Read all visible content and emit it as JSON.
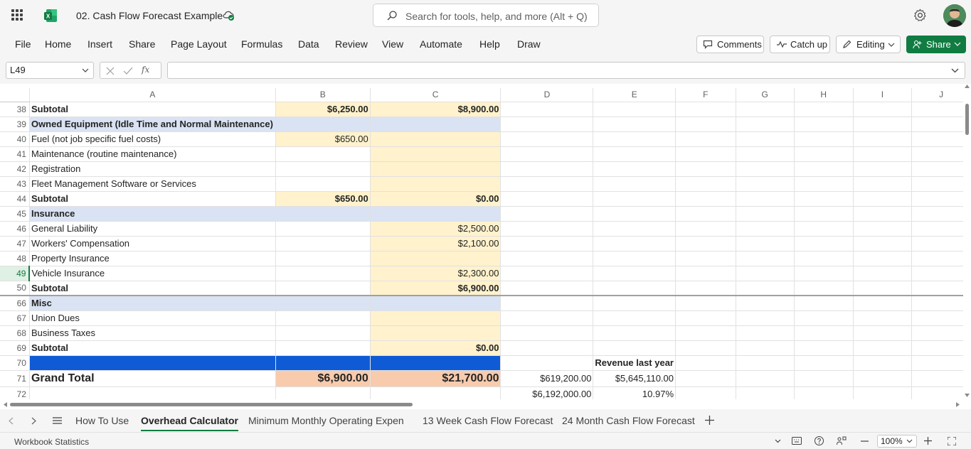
{
  "title_bar": {
    "doc_title": "02. Cash Flow Forecast Example",
    "search_placeholder": "Search for tools, help, and more (Alt + Q)"
  },
  "menu": [
    "File",
    "Home",
    "Insert",
    "Share",
    "Page Layout",
    "Formulas",
    "Data",
    "Review",
    "View",
    "Automate",
    "Help",
    "Draw"
  ],
  "ribbon_buttons": {
    "comments": "Comments",
    "catch_up": "Catch up",
    "editing": "Editing",
    "share": "Share"
  },
  "formula_bar": {
    "name_box": "L49",
    "fx": "fx",
    "formula": ""
  },
  "columns": [
    "A",
    "B",
    "C",
    "D",
    "E",
    "F",
    "G",
    "H",
    "I",
    "J"
  ],
  "rows": [
    {
      "n": "38",
      "a": "Subtotal",
      "b": "$6,250.00",
      "c": "$8,900.00",
      "d": "",
      "e": ""
    },
    {
      "n": "39",
      "a": "Owned Equipment (Idle Time and Normal Maintenance)",
      "b": "",
      "c": "",
      "d": "",
      "e": ""
    },
    {
      "n": "40",
      "a": "Fuel (not job specific fuel costs)",
      "b": "$650.00",
      "c": "",
      "d": "",
      "e": ""
    },
    {
      "n": "41",
      "a": "Maintenance (routine maintenance)",
      "b": "",
      "c": "",
      "d": "",
      "e": ""
    },
    {
      "n": "42",
      "a": "Registration",
      "b": "",
      "c": "",
      "d": "",
      "e": ""
    },
    {
      "n": "43",
      "a": "Fleet Management Software or Services",
      "b": "",
      "c": "",
      "d": "",
      "e": ""
    },
    {
      "n": "44",
      "a": "Subtotal",
      "b": "$650.00",
      "c": "$0.00",
      "d": "",
      "e": ""
    },
    {
      "n": "45",
      "a": "Insurance",
      "b": "",
      "c": "",
      "d": "",
      "e": ""
    },
    {
      "n": "46",
      "a": "General Liability",
      "b": "",
      "c": "$2,500.00",
      "d": "",
      "e": ""
    },
    {
      "n": "47",
      "a": "Workers' Compensation",
      "b": "",
      "c": "$2,100.00",
      "d": "",
      "e": ""
    },
    {
      "n": "48",
      "a": "Property Insurance",
      "b": "",
      "c": "",
      "d": "",
      "e": ""
    },
    {
      "n": "49",
      "a": "Vehicle Insurance",
      "b": "",
      "c": "$2,300.00",
      "d": "",
      "e": ""
    },
    {
      "n": "50",
      "a": "Subtotal",
      "b": "",
      "c": "$6,900.00",
      "d": "",
      "e": ""
    },
    {
      "n": "66",
      "a": "Misc",
      "b": "",
      "c": "",
      "d": "",
      "e": ""
    },
    {
      "n": "67",
      "a": "Union Dues",
      "b": "",
      "c": "",
      "d": "",
      "e": ""
    },
    {
      "n": "68",
      "a": "Business Taxes",
      "b": "",
      "c": "",
      "d": "",
      "e": ""
    },
    {
      "n": "69",
      "a": "Subtotal",
      "b": "",
      "c": "$0.00",
      "d": "",
      "e": ""
    },
    {
      "n": "70",
      "a": "",
      "b": "",
      "c": "",
      "d": "",
      "e": "Revenue last year"
    },
    {
      "n": "71",
      "a": "Grand Total",
      "b": "$6,900.00",
      "c": "$21,700.00",
      "d": "$619,200.00",
      "e": "$5,645,110.00"
    },
    {
      "n": "72",
      "a": "",
      "b": "",
      "c": "",
      "d": "$6,192,000.00",
      "e": "10.97%"
    }
  ],
  "sheet_tabs": [
    "How To Use",
    "Overhead Calculator",
    "Minimum Monthly Operating Expen",
    "13 Week Cash Flow Forecast",
    "24 Month Cash Flow Forecast"
  ],
  "active_tab": "Overhead Calculator",
  "status_bar": {
    "left": "Workbook Statistics",
    "zoom": "100%"
  },
  "colors": {
    "accent": "#107c41",
    "header_blue": "#dae3f3",
    "input_yellow": "#fff2cc",
    "band_blue": "#0f5bd6",
    "grand_total_peach": "#f8cbad"
  }
}
